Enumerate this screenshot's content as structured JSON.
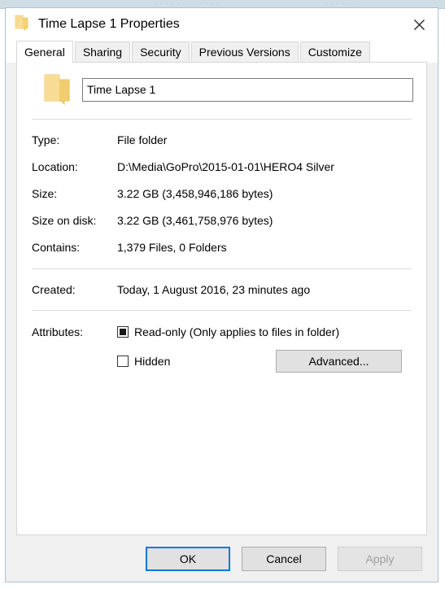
{
  "background": {
    "ghost_text_left": "· · · · · · · · · · · ·",
    "ghost_text_right": "· · · · · ·"
  },
  "window": {
    "title": "Time Lapse 1 Properties",
    "icon": "folder-icon",
    "close_label": "✕"
  },
  "tabs": [
    {
      "label": "General",
      "active": true
    },
    {
      "label": "Sharing",
      "active": false
    },
    {
      "label": "Security",
      "active": false
    },
    {
      "label": "Previous Versions",
      "active": false
    },
    {
      "label": "Customize",
      "active": false
    }
  ],
  "general": {
    "folder_icon": "folder-icon",
    "name_value": "Time Lapse 1",
    "name_placeholder": "",
    "properties": [
      {
        "label": "Type:",
        "value": "File folder"
      },
      {
        "label": "Location:",
        "value": "D:\\Media\\GoPro\\2015-01-01\\HERO4 Silver"
      },
      {
        "label": "Size:",
        "value": "3.22 GB (3,458,946,186 bytes)"
      },
      {
        "label": "Size on disk:",
        "value": "3.22 GB (3,461,758,976 bytes)"
      },
      {
        "label": "Contains:",
        "value": "1,379 Files, 0 Folders"
      }
    ],
    "created": {
      "label": "Created:",
      "value": "Today, 1 August 2016, 23 minutes ago"
    },
    "attributes": {
      "label": "Attributes:",
      "readonly_label": "Read-only (Only applies to files in folder)",
      "readonly_state": "indeterminate",
      "hidden_label": "Hidden",
      "hidden_state": "unchecked",
      "advanced_label": "Advanced..."
    }
  },
  "footer": {
    "ok_label": "OK",
    "cancel_label": "Cancel",
    "apply_label": "Apply"
  },
  "colors": {
    "accent": "#0078d7",
    "folder": "#f6d275",
    "dialog_border": "#a9c4d4",
    "panel_bg": "#ffffff",
    "chrome_bg": "#f0f0f0"
  }
}
